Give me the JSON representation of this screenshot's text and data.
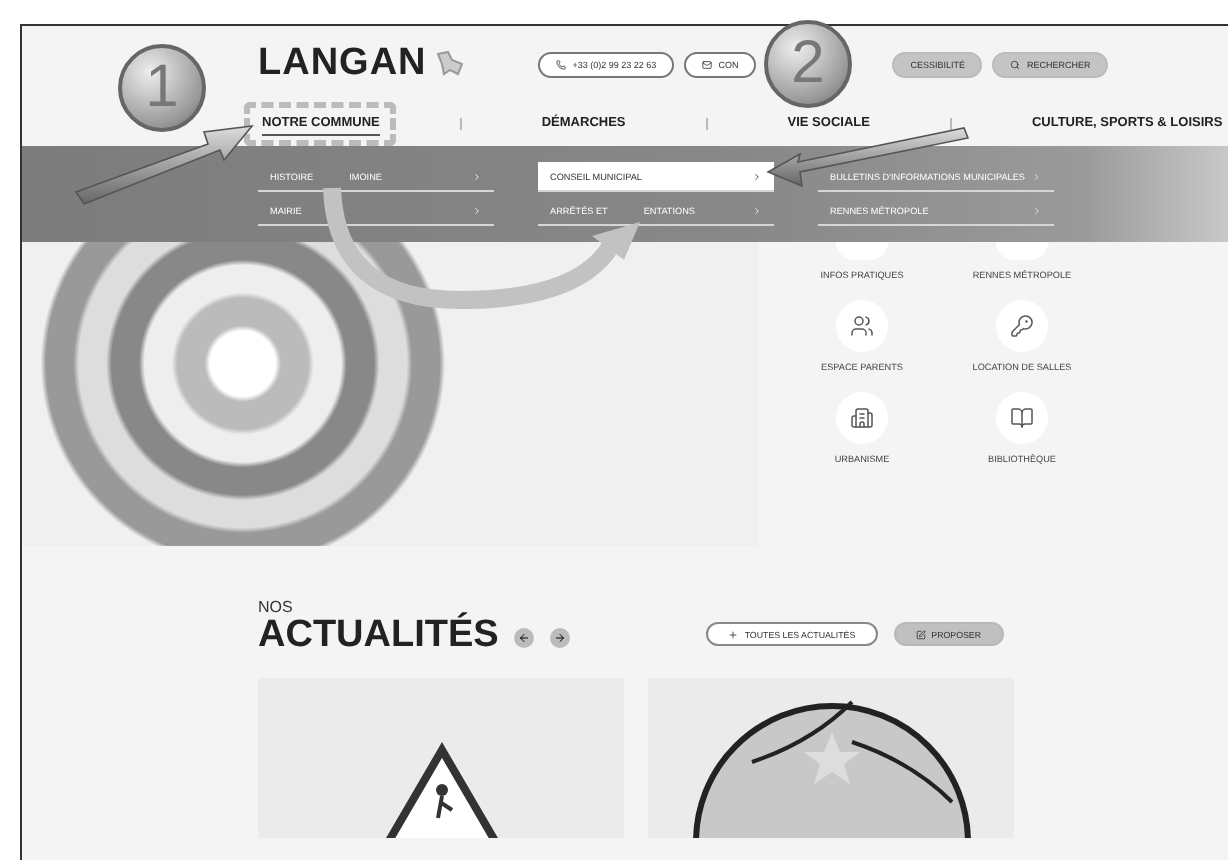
{
  "header": {
    "logo": "LANGAN",
    "phone": "+33 (0)2 99 23 22 63",
    "contact": "CON",
    "accessibility": "CESSIBILITÉ",
    "search": "RECHERCHER"
  },
  "nav": [
    {
      "label": "NOTRE COMMUNE",
      "selected": true
    },
    {
      "label": "DÉMARCHES",
      "selected": false
    },
    {
      "label": "VIE SOCIALE",
      "selected": false
    },
    {
      "label": "CULTURE, SPORTS & LOISIRS",
      "selected": false
    }
  ],
  "submenu": [
    {
      "items": [
        {
          "label": "HISTOIRE",
          "tail": "IMOINE",
          "selected": false
        },
        {
          "label": "MAIRIE",
          "selected": false
        }
      ]
    },
    {
      "items": [
        {
          "label": "CONSEIL MUNICIPAL",
          "selected": true
        },
        {
          "label": "ARRÊTÉS ET",
          "tail": "ENTATIONS",
          "selected": false
        }
      ]
    },
    {
      "items": [
        {
          "label": "BULLETINS D'INFORMATIONS MUNICIPALES",
          "selected": false
        },
        {
          "label": "RENNES MÉTROPOLE",
          "selected": false
        }
      ]
    }
  ],
  "quick_links": [
    {
      "label": "INFOS PRATIQUES",
      "kind": "cut"
    },
    {
      "label": "RENNES MÉTROPOLE",
      "kind": "cut"
    },
    {
      "label": "ESPACE PARENTS",
      "kind": "full"
    },
    {
      "label": "LOCATION DE SALLES",
      "kind": "full"
    },
    {
      "label": "URBANISME",
      "kind": "full"
    },
    {
      "label": "BIBLIOTHÈQUE",
      "kind": "full"
    }
  ],
  "news": {
    "kicker": "NOS",
    "title": "ACTUALITÉS",
    "all_button": "TOUTES LES ACTUALITÉS",
    "propose_button": "PROPOSER"
  },
  "annotations": [
    "1",
    "2"
  ]
}
